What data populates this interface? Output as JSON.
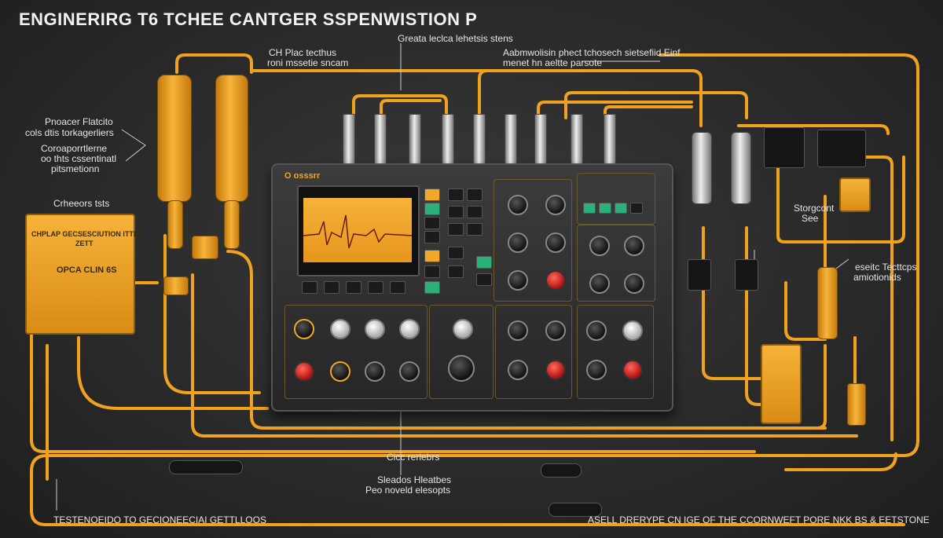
{
  "title": "ENGINERIRG T6 TCHEE CANTGER SSPENWISTION P",
  "labels": {
    "top_left_1": "CH Plac tecthus",
    "top_left_2": "roni mssetie sncam",
    "top_center": "Greata leclca lehetsis stens",
    "top_right_1": "Aabmwolisin phect tchosech sietsefiid Einf",
    "top_right_2": "menet hn aeltte parsote",
    "left_1": "Pnoacer Flatcito",
    "left_2": "cols dtis torkagerliers",
    "left_3": "Coroaporrtlerne",
    "left_4": "oo thts cssentinatl",
    "left_5": "pitsmetionn",
    "left_6": "Crheeors tsts",
    "box_label_1": "CHPLAP GECSESCIUTION ITTEP",
    "box_label_2": "ZETT",
    "box_label_3": "OPCA CLIN 6S",
    "right_1": "Storgcont",
    "right_2": "See",
    "right_3": "eseitc Tecttcps",
    "right_4": "amiotionids",
    "bottom_center_1": "Cicc rerlebrs",
    "bottom_center_2": "Sleados Hleatbes",
    "bottom_center_3": "Peo noveld elesopts",
    "footer_left": "TESTENOEIDO TO GECIONEECIAI GETTLLOOS",
    "footer_right": "ASELL DRERYPE CN IGE OF THE CCORNWEFT PORE NKK BS & EETSTONE",
    "panel_brand": "O osssrr"
  },
  "colors": {
    "wire": "#f0a21e",
    "accent": "#f3a51d",
    "background": "#2c2c2c",
    "panel": "#333333",
    "trace": "#6a1a10"
  },
  "icons": [
    "screen-icon",
    "knob-icon",
    "connector-icon",
    "plug-icon",
    "cylinder-icon"
  ]
}
